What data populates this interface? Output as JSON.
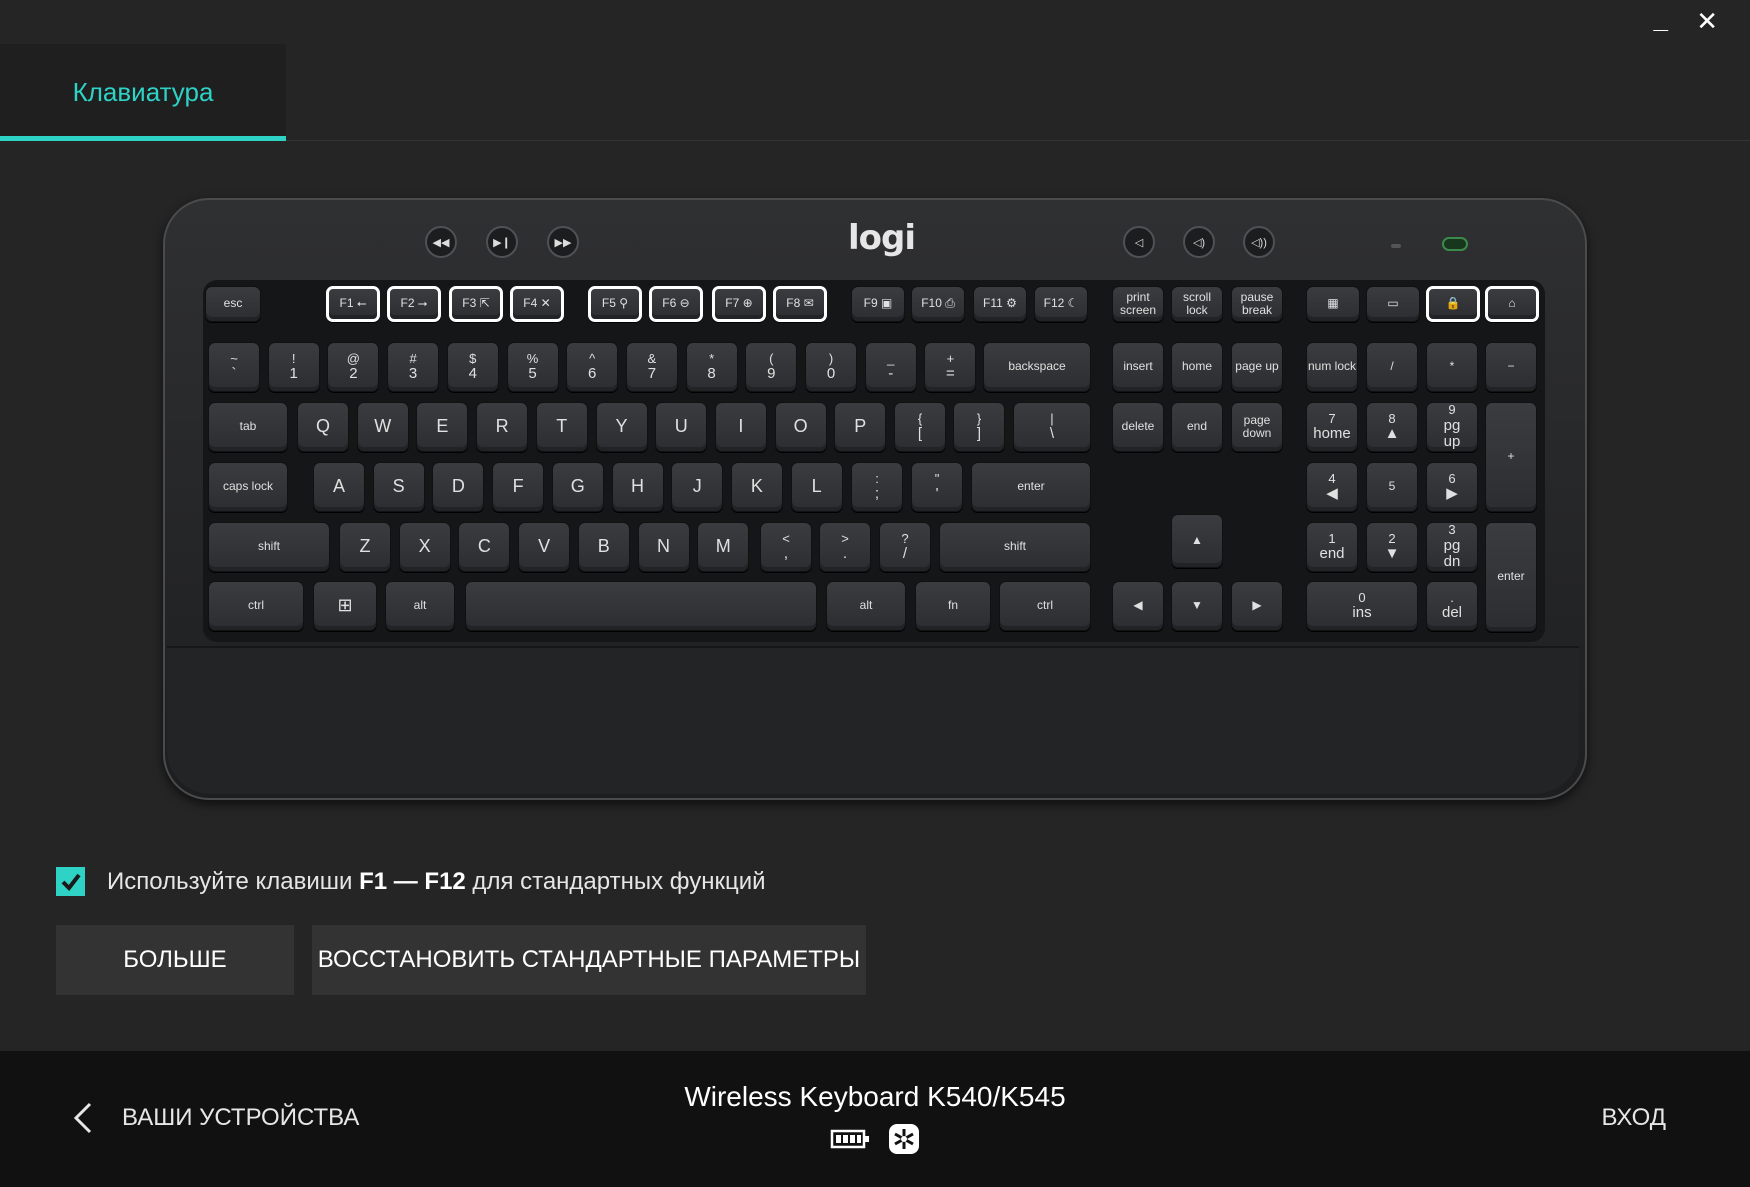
{
  "window": {
    "minimize": "_",
    "close": "✕"
  },
  "tabs": [
    {
      "label": "Клавиатура",
      "active": true
    }
  ],
  "keyboard": {
    "logo": "logi",
    "fn_row": [
      {
        "label": "esc"
      },
      {
        "label": "F1",
        "sub": "⭠"
      },
      {
        "label": "F2",
        "sub": "⭢"
      },
      {
        "label": "F3",
        "sub": "⇱"
      },
      {
        "label": "F4",
        "sub": "✕"
      },
      {
        "label": "F5",
        "sub": "⚲"
      },
      {
        "label": "F6",
        "sub": "⊖"
      },
      {
        "label": "F7",
        "sub": "⊕"
      },
      {
        "label": "F8",
        "sub": "✉"
      },
      {
        "label": "F9",
        "sub": "▣"
      },
      {
        "label": "F10",
        "sub": "⎙"
      },
      {
        "label": "F11",
        "sub": "⚙"
      },
      {
        "label": "F12",
        "sub": "☾"
      },
      {
        "label": "print screen"
      },
      {
        "label": "scroll lock"
      },
      {
        "label": "pause break"
      },
      {
        "label": "▦"
      },
      {
        "label": "▭"
      },
      {
        "label": "🔒"
      },
      {
        "label": "⌂"
      }
    ],
    "row1": [
      [
        "~",
        "`"
      ],
      [
        "!",
        "1"
      ],
      [
        "@",
        "2"
      ],
      [
        "#",
        "3"
      ],
      [
        "$",
        "4"
      ],
      [
        "%",
        "5"
      ],
      [
        "^",
        "6"
      ],
      [
        "&",
        "7"
      ],
      [
        "*",
        "8"
      ],
      [
        "(",
        "9"
      ],
      [
        ")",
        "0"
      ],
      [
        "_",
        "-"
      ],
      [
        "+",
        "="
      ],
      [
        "",
        "backspace"
      ]
    ],
    "row2": [
      "tab",
      "Q",
      "W",
      "E",
      "R",
      "T",
      "Y",
      "U",
      "I",
      "O",
      "P",
      [
        "{",
        "["
      ],
      [
        "}",
        "]"
      ],
      [
        "|",
        "\\"
      ]
    ],
    "row3": [
      "caps lock",
      "A",
      "S",
      "D",
      "F",
      "G",
      "H",
      "J",
      "K",
      "L",
      [
        ":",
        ";"
      ],
      [
        "\"",
        "'"
      ],
      "enter"
    ],
    "row4": [
      "shift",
      "Z",
      "X",
      "C",
      "V",
      "B",
      "N",
      "M",
      [
        "<",
        ","
      ],
      [
        ">",
        "."
      ],
      [
        "?",
        "/"
      ],
      "shift"
    ],
    "row5": [
      "ctrl",
      "⊞",
      "alt",
      "",
      "alt",
      "fn",
      "ctrl"
    ],
    "nav": [
      "insert",
      "home",
      "page up",
      "delete",
      "end",
      "page down"
    ],
    "arrows": [
      "▲",
      "◀",
      "▼",
      "▶"
    ],
    "numpad": [
      [
        "num lock",
        "/",
        "*",
        "−"
      ],
      [
        "7 home",
        "8 ▲",
        "9 pg up",
        "+"
      ],
      [
        "4 ◀",
        "5",
        "6 ▶"
      ],
      [
        "1 end",
        "2 ▼",
        "3 pg dn",
        "enter"
      ],
      [
        "0 ins",
        ". del"
      ]
    ]
  },
  "option": {
    "checked": true,
    "text_before": "Используйте клавиши ",
    "text_bold": "F1 — F12",
    "text_after": " для стандартных функций"
  },
  "buttons": {
    "more": "БОЛЬШЕ",
    "reset": "ВОССТАНОВИТЬ СТАНДАРТНЫЕ ПАРАМЕТРЫ"
  },
  "footer": {
    "back_label": "ВАШИ УСТРОЙСТВА",
    "device_name": "Wireless Keyboard K540/K545",
    "battery_icon": "battery-icon",
    "connection_icon": "unifying-receiver-icon",
    "login": "ВХОД"
  },
  "colors": {
    "accent": "#2ed3c6",
    "background": "#252525",
    "footer": "#111111"
  }
}
